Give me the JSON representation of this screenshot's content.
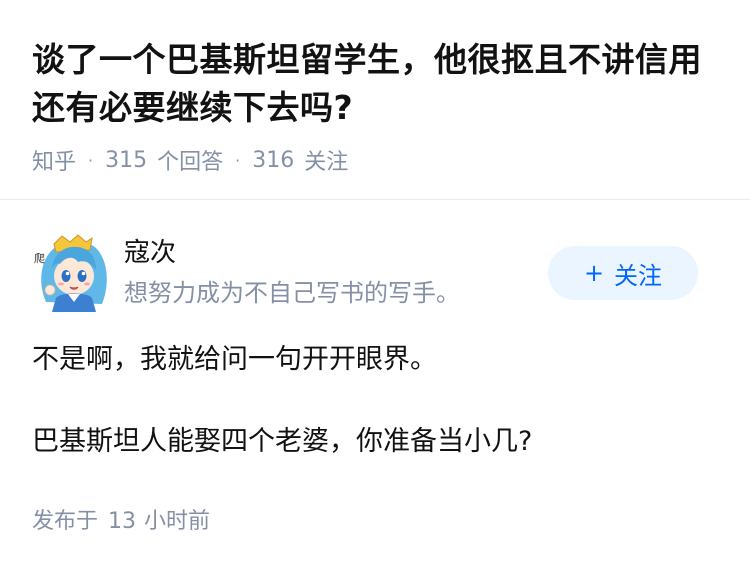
{
  "question": {
    "title": "谈了一个巴基斯坦留学生，他很抠且不讲信用还有必要继续下去吗?",
    "source": "知乎",
    "answer_count": "315",
    "answer_label": "个回答",
    "follower_count": "316",
    "follower_label": "关注"
  },
  "author": {
    "name": "寇次",
    "bio": "想努力成为不自己写书的写手。",
    "avatar_icon": "anime-avatar-icon",
    "follow_label": "关注"
  },
  "answer": {
    "paragraphs": [
      "不是啊，我就给问一句开开眼界。",
      "巴基斯坦人能娶四个老婆，你准备当小几?"
    ],
    "published_prefix": "发布于",
    "published_num": "13",
    "published_suffix": "小时前"
  },
  "colors": {
    "meta_gray": "#8590a6",
    "accent_blue": "#0066ff",
    "button_bg": "#ebf5ff"
  }
}
